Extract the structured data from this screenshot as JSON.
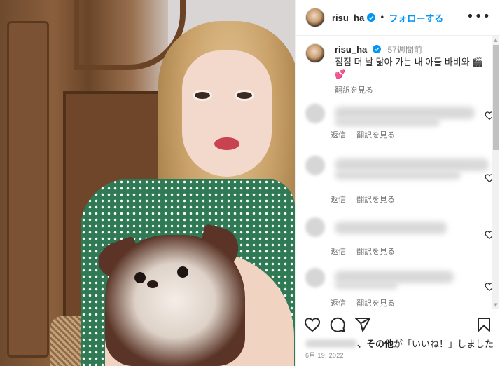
{
  "post": {
    "username": "risu_ha",
    "follow_label": "フォローする",
    "dot": "•",
    "more_label": "•••",
    "caption_time": "57週間前",
    "caption_text": "점점 더 날 닮아 가는 내 아들 바비와",
    "caption_emoji": "💕",
    "translate_label": "翻訳を見る"
  },
  "comments": [
    {
      "reply_label": "返信",
      "translate_label": "翻訳を見る"
    },
    {
      "reply_label": "返信",
      "translate_label": "翻訳を見る"
    },
    {
      "reply_label": "返信",
      "translate_label": "翻訳を見る"
    },
    {
      "reply_label": "返信",
      "translate_label": "翻訳を見る"
    }
  ],
  "likes": {
    "suffix_bold": "、その他",
    "suffix_text": "が「いいね！」しました"
  },
  "date": "6月 19, 2022",
  "colors": {
    "accent": "#0095f6",
    "verified": "#0095f6",
    "text": "#262626",
    "muted": "#737373"
  },
  "icons": [
    "verified-badge-icon",
    "more-options-icon",
    "heart-icon",
    "comment-icon",
    "share-icon",
    "bookmark-icon"
  ]
}
